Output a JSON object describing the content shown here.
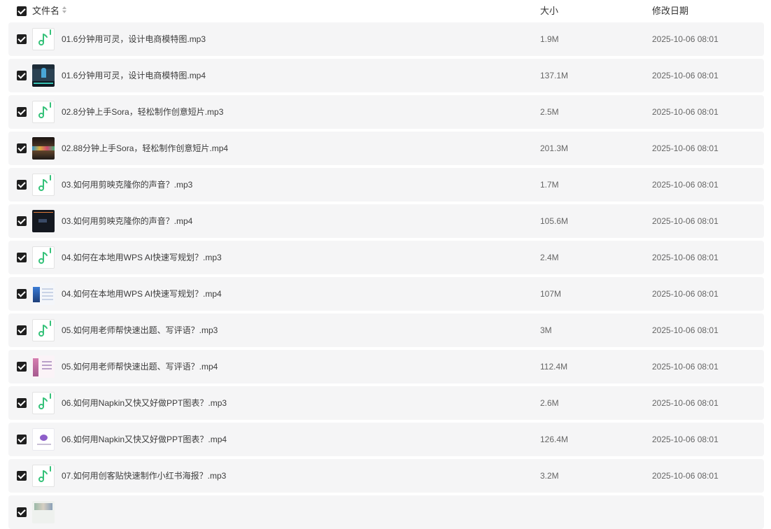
{
  "header": {
    "name_label": "文件名",
    "size_label": "大小",
    "date_label": "修改日期",
    "select_all_checked": true
  },
  "accent_color": "#36c27a",
  "rows": [
    {
      "name": "01.6分钟用可灵，设计电商模特图.mp3",
      "size": "1.9M",
      "date": "2025-10-06 08:01",
      "kind": "audio",
      "checked": true
    },
    {
      "name": "01.6分钟用可灵，设计电商模特图.mp4",
      "size": "137.1M",
      "date": "2025-10-06 08:01",
      "kind": "video",
      "checked": true
    },
    {
      "name": "02.8分钟上手Sora，轻松制作创意短片.mp3",
      "size": "2.5M",
      "date": "2025-10-06 08:01",
      "kind": "audio",
      "checked": true
    },
    {
      "name": "02.88分钟上手Sora，轻松制作创意短片.mp4",
      "size": "201.3M",
      "date": "2025-10-06 08:01",
      "kind": "video",
      "checked": true
    },
    {
      "name": "03.如何用剪映克隆你的声音？.mp3",
      "size": "1.7M",
      "date": "2025-10-06 08:01",
      "kind": "audio",
      "checked": true
    },
    {
      "name": "03.如何用剪映克隆你的声音？.mp4",
      "size": "105.6M",
      "date": "2025-10-06 08:01",
      "kind": "video",
      "checked": true
    },
    {
      "name": "04.如何在本地用WPS AI快速写规划？.mp3",
      "size": "2.4M",
      "date": "2025-10-06 08:01",
      "kind": "audio",
      "checked": true
    },
    {
      "name": "04.如何在本地用WPS AI快速写规划？.mp4",
      "size": "107M",
      "date": "2025-10-06 08:01",
      "kind": "video",
      "checked": true
    },
    {
      "name": "05.如何用老师帮快速出题、写评语？.mp3",
      "size": "3M",
      "date": "2025-10-06 08:01",
      "kind": "audio",
      "checked": true
    },
    {
      "name": "05.如何用老师帮快速出题、写评语？.mp4",
      "size": "112.4M",
      "date": "2025-10-06 08:01",
      "kind": "video",
      "checked": true
    },
    {
      "name": "06.如何用Napkin又快又好做PPT图表？.mp3",
      "size": "2.6M",
      "date": "2025-10-06 08:01",
      "kind": "audio",
      "checked": true
    },
    {
      "name": "06.如何用Napkin又快又好做PPT图表？.mp4",
      "size": "126.4M",
      "date": "2025-10-06 08:01",
      "kind": "video",
      "checked": true
    },
    {
      "name": "07.如何用创客贴快速制作小红书海报？.mp3",
      "size": "3.2M",
      "date": "2025-10-06 08:01",
      "kind": "audio",
      "checked": true
    },
    {
      "name": "",
      "size": "",
      "date": "",
      "kind": "video",
      "checked": true
    }
  ]
}
